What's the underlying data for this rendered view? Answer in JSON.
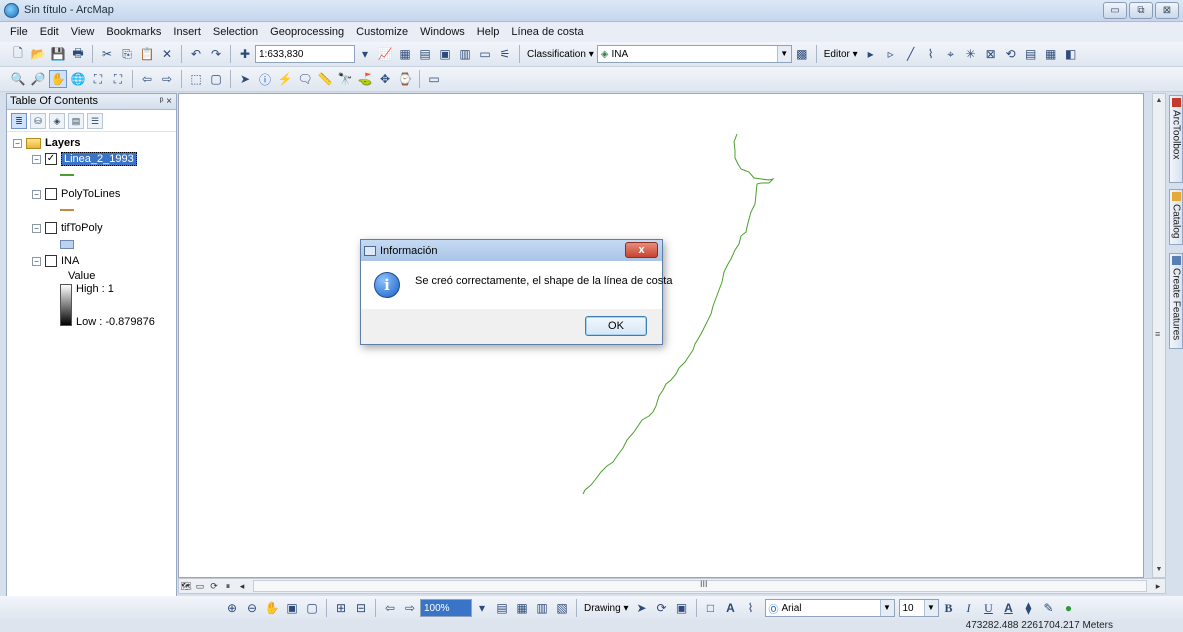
{
  "window": {
    "title": "Sin título - ArcMap",
    "controls": [
      "▭",
      "⧉",
      "⊠"
    ]
  },
  "menu": [
    "File",
    "Edit",
    "View",
    "Bookmarks",
    "Insert",
    "Selection",
    "Geoprocessing",
    "Customize",
    "Windows",
    "Help",
    "Línea de costa"
  ],
  "toolbar_standard": {
    "scale_value": "1:633,830",
    "classification_label": "Classification",
    "layer_combo_value": "INA",
    "editor_label": "Editor"
  },
  "toc": {
    "header": "Table Of Contents",
    "pin": "ᵖ ×",
    "group_label": "Layers",
    "layers": [
      {
        "label": "Linea_2_1993",
        "checked": "✓",
        "symbol_color": "#4aa02c"
      },
      {
        "label": "PolyToLines",
        "checked": "",
        "symbol_color": "#c8893e"
      },
      {
        "label": "tifToPoly",
        "checked": "",
        "symbol_color": "#bed2ee"
      },
      {
        "label": "INA",
        "checked": ""
      }
    ],
    "ina_legend": {
      "value_label": "Value",
      "high_label": "High : 1",
      "low_label": "Low : -0.879876"
    }
  },
  "dock_tabs": [
    "ArcToolbox",
    "Catalog",
    "Create Features"
  ],
  "dialog": {
    "title": "Información",
    "close_label": "x",
    "message": "Se creó correctamente, el shape de la línea de costa",
    "ok_label": "OK"
  },
  "drawing_toolbar": {
    "zoom_value": "100%",
    "drawing_label": "Drawing",
    "font_value": "Arial",
    "font_size_value": "10",
    "bold": "B",
    "italic": "I",
    "underline": "U",
    "font_color_label": "A"
  },
  "status": {
    "coordinates": "473282.488  2261704.217 Meters"
  },
  "map": {
    "line_color": "#4aa02c"
  }
}
